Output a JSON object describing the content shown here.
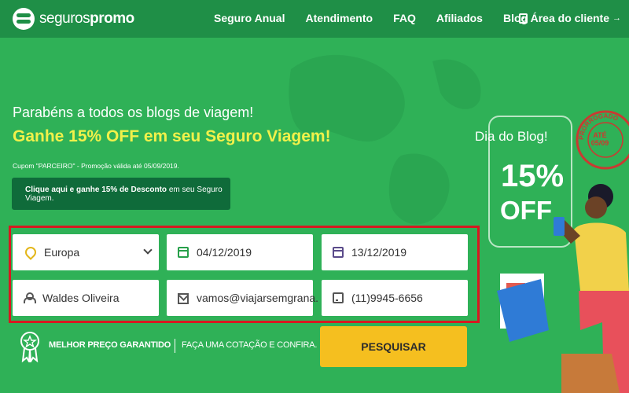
{
  "header": {
    "logo_light": "seguros",
    "logo_bold": "promo",
    "nav": [
      "Seguro Anual",
      "Atendimento",
      "FAQ",
      "Afiliados",
      "Blog"
    ],
    "client_area": "Área do cliente"
  },
  "hero": {
    "title": "Parabéns a todos os blogs de viagem!",
    "subtitle": "Ganhe 15% OFF em seu Seguro Viagem!",
    "promo_note": "Cupom \"PARCEIRO\" - Promoção válida até 05/09/2019.",
    "cta_bold": "Clique aqui e ganhe 15% de Desconto",
    "cta_rest": " em seu Seguro Viagem."
  },
  "form": {
    "destination": "Europa",
    "departure_date": "04/12/2019",
    "return_date": "13/12/2019",
    "name": "Waldes Oliveira",
    "email": "vamos@viajarsemgrana.",
    "phone": "(11)9945-6656"
  },
  "footer_row": {
    "guarantee": "MELHOR PREÇO GARANTIDO",
    "quote": "FAÇA UMA COTAÇÃO E CONFIRA.",
    "search_button": "PESQUISAR"
  },
  "promo_card": {
    "title": "Dia do Blog!",
    "percent": "15%",
    "off": "OFF",
    "stamp_top": "PRORROGADO",
    "stamp_center": "ATÉ 05/09"
  },
  "colors": {
    "background": "#2fb157",
    "topbar": "#1f8f47",
    "accent_yellow": "#f1f14a",
    "button_yellow": "#f5bf1f",
    "highlight_border": "#d71920"
  },
  "icons": [
    "logo-icon",
    "user-card-icon",
    "location-pin-icon",
    "calendar-icon",
    "calendar-return-icon",
    "person-icon",
    "envelope-icon",
    "phone-icon",
    "medal-icon",
    "chevron-down-icon"
  ]
}
